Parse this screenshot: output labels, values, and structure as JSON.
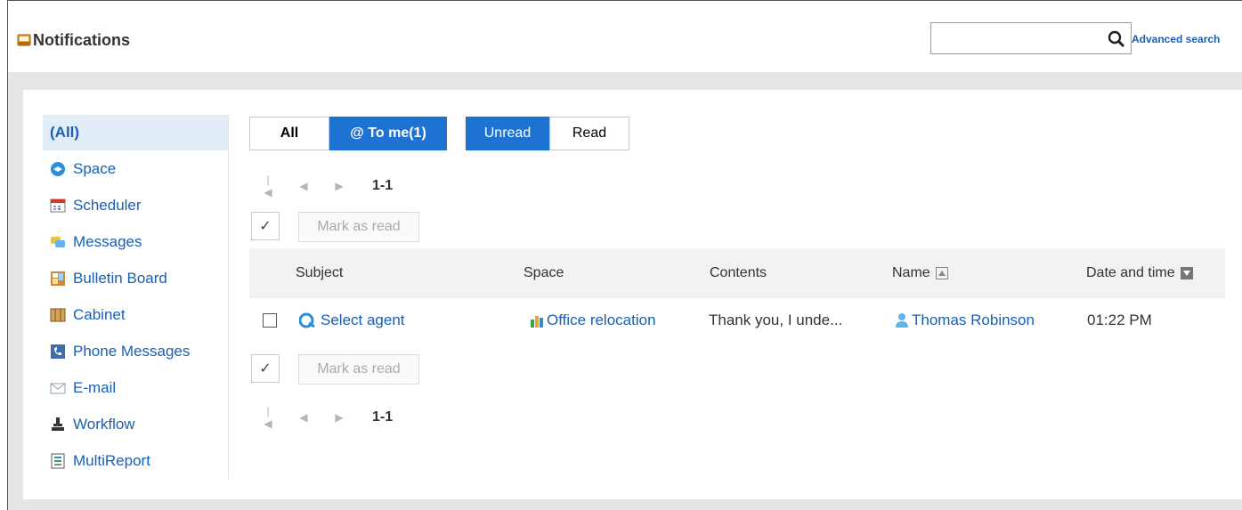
{
  "header": {
    "title": "Notifications",
    "search_value": "",
    "search_placeholder": "",
    "advanced_search": "Advanced search"
  },
  "sidebar": {
    "items": [
      {
        "label": "(All)",
        "icon": "all"
      },
      {
        "label": "Space",
        "icon": "space-icon"
      },
      {
        "label": "Scheduler",
        "icon": "calendar-icon"
      },
      {
        "label": "Messages",
        "icon": "messages-icon"
      },
      {
        "label": "Bulletin Board",
        "icon": "bulletin-icon"
      },
      {
        "label": "Cabinet",
        "icon": "cabinet-icon"
      },
      {
        "label": "Phone Messages",
        "icon": "phone-icon"
      },
      {
        "label": "E-mail",
        "icon": "mail-icon"
      },
      {
        "label": "Workflow",
        "icon": "workflow-icon"
      },
      {
        "label": "MultiReport",
        "icon": "report-icon"
      }
    ]
  },
  "filters": {
    "scope": [
      {
        "label": "All",
        "selected": false
      },
      {
        "label": "@ To me(1)",
        "selected": true
      }
    ],
    "status": [
      {
        "label": "Unread",
        "selected": true
      },
      {
        "label": "Read",
        "selected": false
      }
    ]
  },
  "pager": {
    "range": "1-1"
  },
  "actions": {
    "check_all": "✓",
    "mark_as_read": "Mark as read"
  },
  "table": {
    "columns": [
      "Subject",
      "Space",
      "Contents",
      "Name",
      "Date and time"
    ],
    "rows": [
      {
        "subject": "Select agent",
        "space": "Office relocation",
        "contents": "Thank you, I unde...",
        "name": "Thomas Robinson",
        "datetime": "01:22 PM"
      }
    ]
  },
  "colors": {
    "accent": "#1e73d2",
    "link": "#1a5fb4",
    "active_bg": "#e3edf8"
  }
}
